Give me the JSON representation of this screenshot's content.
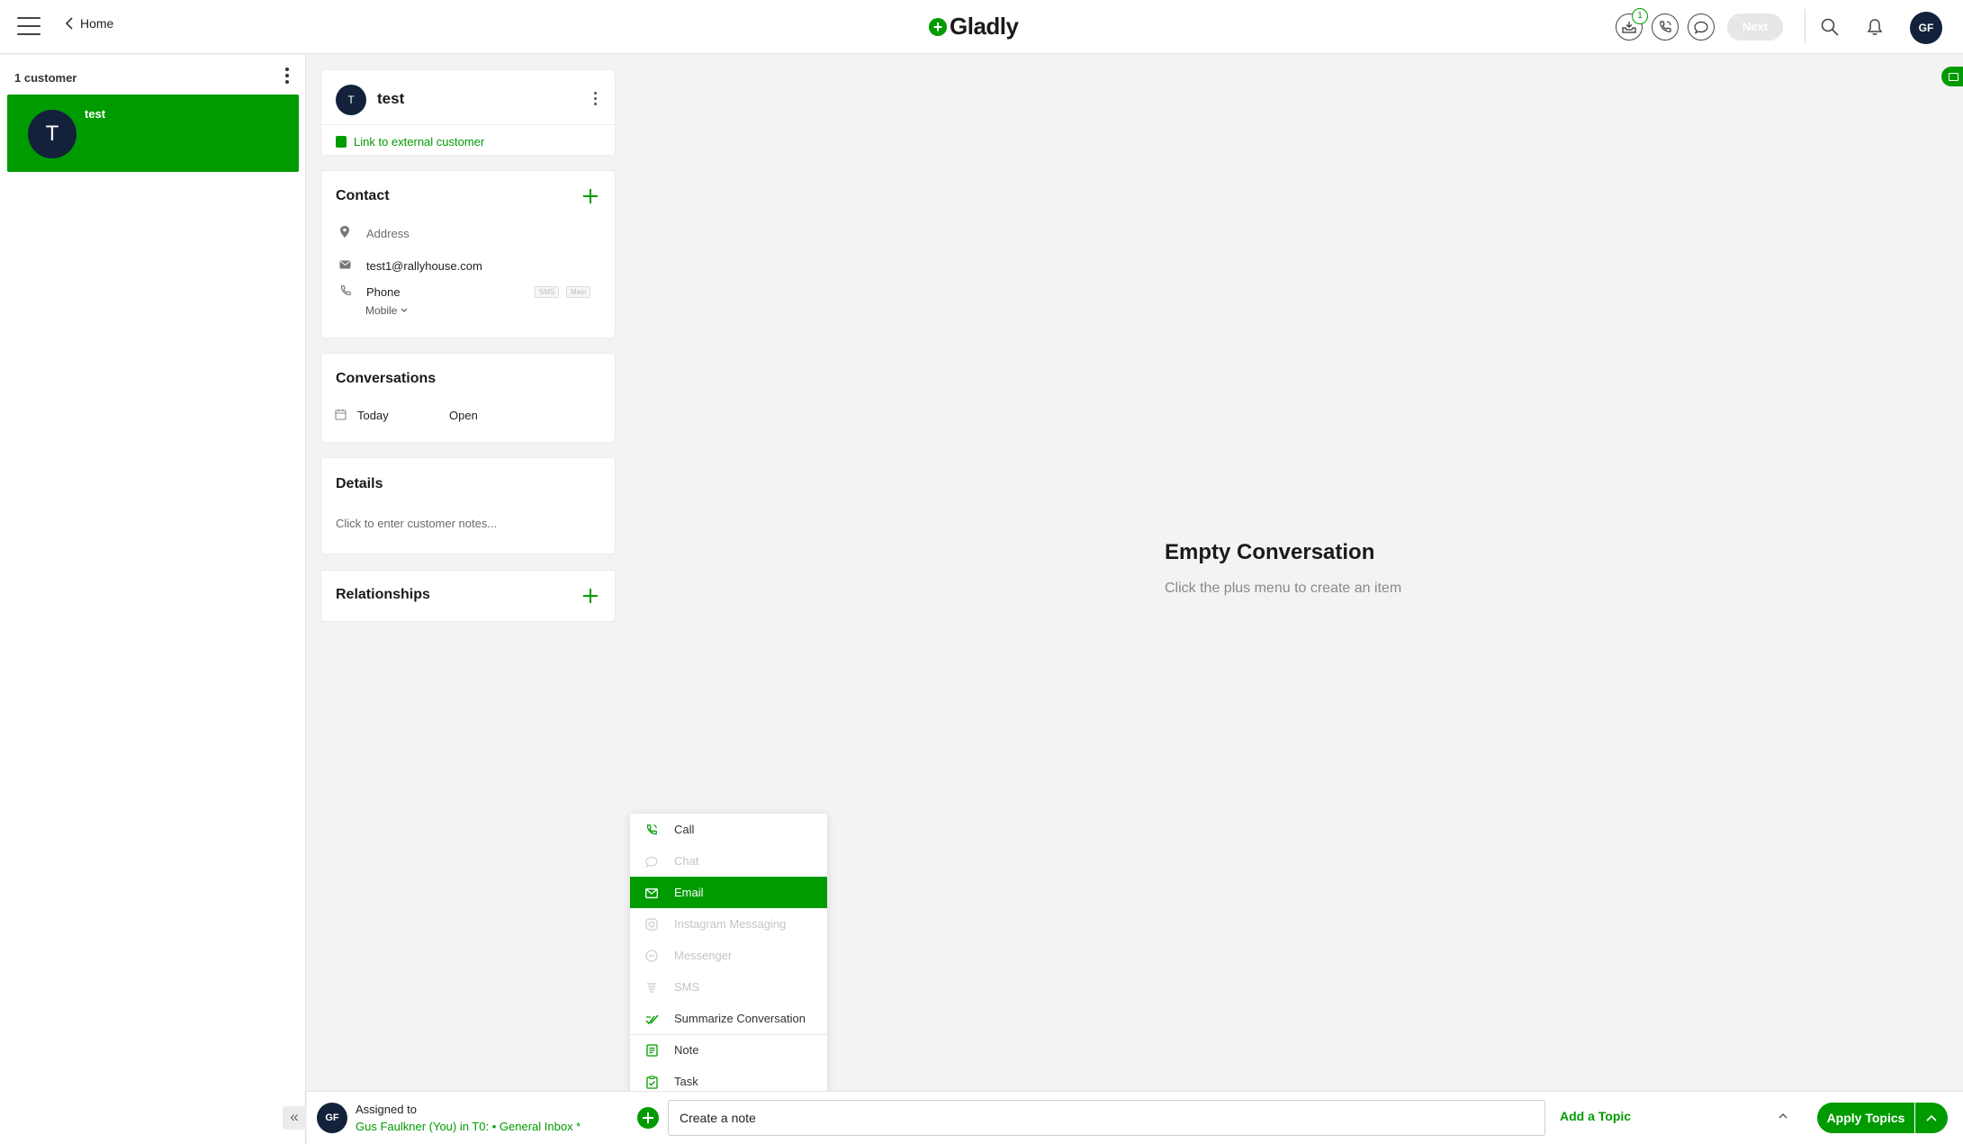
{
  "header": {
    "nav_back_label": "Home",
    "logo_text": "Gladly",
    "inbox_badge": "1",
    "next_label": "Next",
    "user_initials": "GF"
  },
  "customer_list": {
    "count_label": "1 customer",
    "customers": [
      {
        "initial": "T",
        "name": "test"
      }
    ]
  },
  "profile": {
    "initial": "T",
    "name": "test",
    "link_label": "Link to external customer"
  },
  "contact": {
    "title": "Contact",
    "address_placeholder": "Address",
    "email": "test1@rallyhouse.com",
    "phone_placeholder": "Phone",
    "phone_tags": [
      "SMS",
      "Main"
    ],
    "phone_type": "Mobile"
  },
  "conversations": {
    "title": "Conversations",
    "items": [
      {
        "date": "Today",
        "status": "Open"
      }
    ]
  },
  "details": {
    "title": "Details",
    "notes_placeholder": "Click to enter customer notes..."
  },
  "relationships": {
    "title": "Relationships"
  },
  "conversation_area": {
    "empty_title": "Empty Conversation",
    "empty_subtitle": "Click the plus menu to create an item"
  },
  "create_menu": {
    "items": [
      {
        "label": "Call",
        "icon": "phone-icon",
        "state": "enabled"
      },
      {
        "label": "Chat",
        "icon": "chat-icon",
        "state": "disabled"
      },
      {
        "label": "Email",
        "icon": "envelope-icon",
        "state": "active"
      },
      {
        "label": "Instagram Messaging",
        "icon": "instagram-icon",
        "state": "disabled"
      },
      {
        "label": "Messenger",
        "icon": "messenger-icon",
        "state": "disabled"
      },
      {
        "label": "SMS",
        "icon": "sms-icon",
        "state": "disabled"
      },
      {
        "label": "Summarize Conversation",
        "icon": "summarize-icon",
        "state": "enabled"
      },
      {
        "label": "Note",
        "icon": "note-icon",
        "state": "enabled"
      },
      {
        "label": "Task",
        "icon": "task-icon",
        "state": "enabled"
      }
    ]
  },
  "footer": {
    "assignee_initials": "GF",
    "assigned_label": "Assigned to",
    "assignee_value": "Gus Faulkner (You) in T0: • General Inbox *",
    "composer_placeholder": "Create a note",
    "add_topic_label": "Add a Topic",
    "apply_label": "Apply Topics"
  },
  "colors": {
    "brand_green": "#009b00",
    "avatar_navy": "#13213a",
    "background": "#f3f3f3"
  }
}
